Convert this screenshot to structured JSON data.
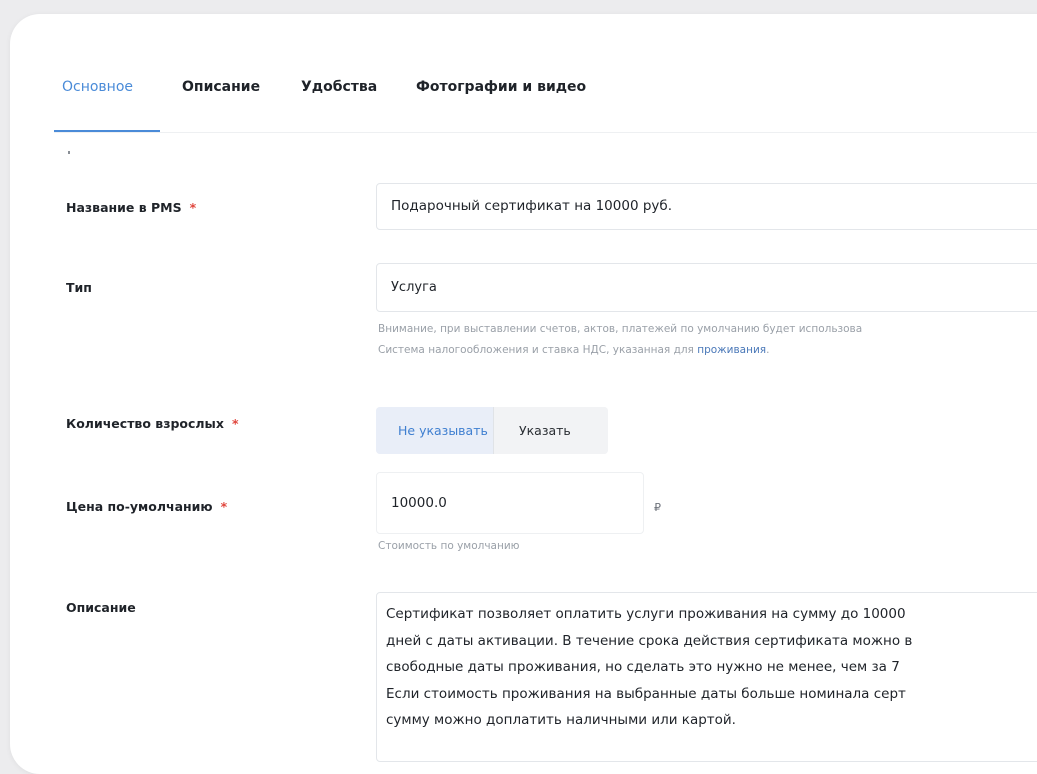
{
  "tabs": [
    {
      "label": "Основное",
      "active": true
    },
    {
      "label": "Описание",
      "active": false
    },
    {
      "label": "Удобства",
      "active": false
    },
    {
      "label": "Фотографии и видео",
      "active": false
    }
  ],
  "form": {
    "pms_name": {
      "label": "Название в PMS",
      "required_mark": "*",
      "value": "Подарочный сертификат на 10000 руб."
    },
    "type": {
      "label": "Тип",
      "value": "Услуга",
      "hint_line1": "Внимание, при выставлении счетов, актов, платежей по умолчанию будет использова",
      "hint_line2_prefix": "Система налогообложения и ставка НДС, указанная для ",
      "hint_link": "проживания",
      "hint_line2_suffix": "."
    },
    "adults": {
      "label": "Количество взрослых",
      "required_mark": "*",
      "options": [
        "Не указывать",
        "Указать"
      ],
      "selected": "Не указывать"
    },
    "price": {
      "label": "Цена по-умолчанию",
      "required_mark": "*",
      "value": "10000.0",
      "currency": "₽",
      "hint": "Стоимость по умолчанию"
    },
    "description": {
      "label": "Описание",
      "lines": [
        "Сертификат позволяет оплатить услуги проживания на сумму до 10000",
        "дней с даты активации. В течение срока действия сертификата можно в",
        "свободные даты проживания, но сделать это нужно не менее, чем за 7",
        "Если стоимость проживания на выбранные даты больше номинала серт",
        "сумму можно доплатить наличными или картой."
      ]
    }
  },
  "colors": {
    "accent": "#4a8bd8",
    "required": "#e0463d",
    "hint": "#9aa0a8"
  }
}
